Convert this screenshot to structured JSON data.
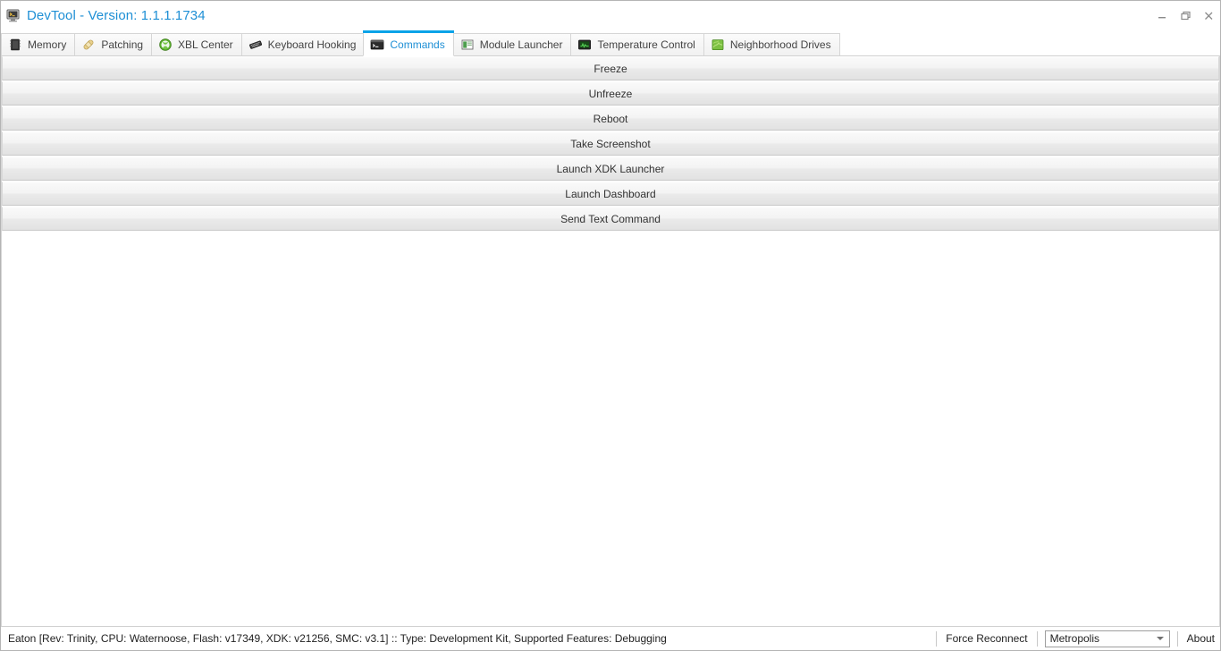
{
  "window": {
    "title": "DevTool - Version: 1.1.1.1734",
    "icon": "console-monitor-icon",
    "controls": {
      "minimize": "minimize-icon",
      "restore": "restore-icon",
      "close": "close-icon"
    }
  },
  "tabs": [
    {
      "label": "Memory",
      "icon": "memory-chip-icon",
      "active": false
    },
    {
      "label": "Patching",
      "icon": "bandage-icon",
      "active": false
    },
    {
      "label": "XBL Center",
      "icon": "xbox-sphere-icon",
      "active": false
    },
    {
      "label": "Keyboard Hooking",
      "icon": "keyboard-icon",
      "active": false
    },
    {
      "label": "Commands",
      "icon": "console-prompt-icon",
      "active": true
    },
    {
      "label": "Module Launcher",
      "icon": "window-module-icon",
      "active": false
    },
    {
      "label": "Temperature Control",
      "icon": "green-monitor-icon",
      "active": false
    },
    {
      "label": "Neighborhood Drives",
      "icon": "green-drive-icon",
      "active": false
    }
  ],
  "commands": [
    {
      "label": "Freeze"
    },
    {
      "label": "Unfreeze"
    },
    {
      "label": "Reboot"
    },
    {
      "label": "Take Screenshot"
    },
    {
      "label": "Launch XDK Launcher"
    },
    {
      "label": "Launch Dashboard"
    },
    {
      "label": "Send Text Command"
    }
  ],
  "statusbar": {
    "console_info": "Eaton [Rev: Trinity, CPU: Waternoose, Flash: v17349, XDK: v21256, SMC: v3.1] :: Type: Development Kit, Supported Features: Debugging",
    "force_reconnect_label": "Force Reconnect",
    "console_select_value": "Metropolis",
    "about_label": "About"
  },
  "colors": {
    "accent_blue": "#09a3e8",
    "title_blue": "#1e8fd5",
    "button_face": "#f1f1f1",
    "border_gray": "#d6d6d6"
  }
}
